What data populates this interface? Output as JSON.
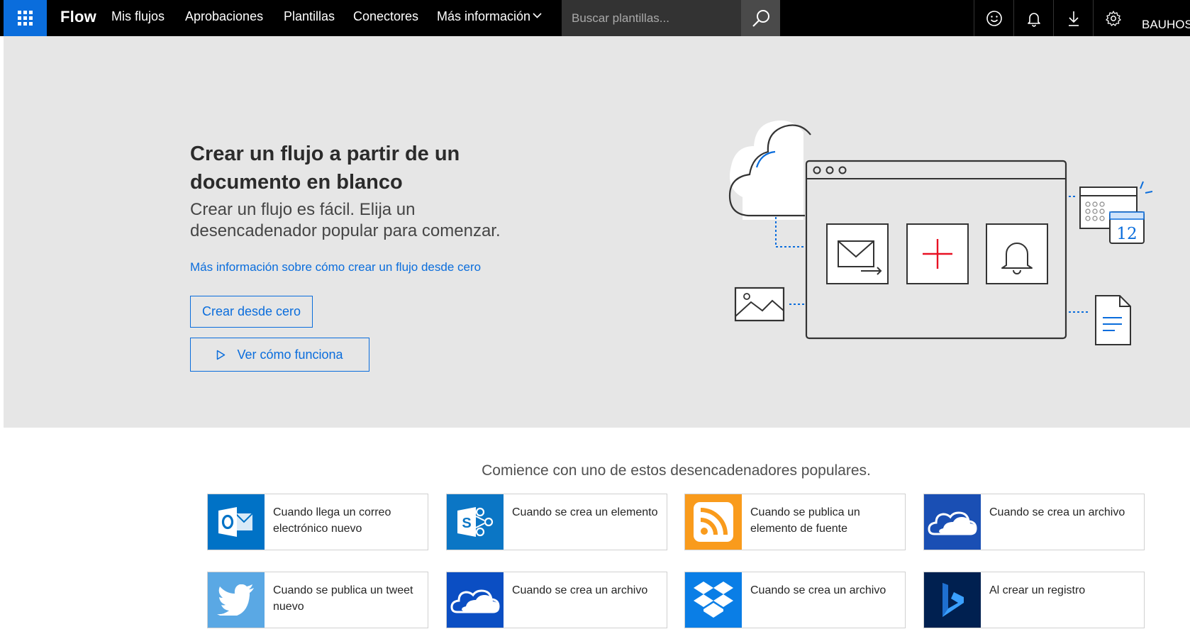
{
  "topbar": {
    "brand": "Flow",
    "nav": [
      "Mis flujos",
      "Aprobaciones",
      "Plantillas",
      "Conectores",
      "Más información"
    ],
    "search_placeholder": "Buscar plantillas...",
    "user": "BAUHOS",
    "accent": "#0a6ddc",
    "icons": [
      "app-launcher-icon",
      "search-icon",
      "smiley-icon",
      "bell-icon",
      "download-icon",
      "gear-icon"
    ]
  },
  "hero": {
    "title": "Crear un flujo a partir de un documento en blanco",
    "subtitle": "Crear un flujo es fácil. Elija un desencadenador popular para comenzar.",
    "link": "Más información sobre cómo crear un flujo desde cero",
    "create_button": "Crear desde cero",
    "watch_button": "Ver cómo funciona",
    "calendar_day": "12"
  },
  "triggers": {
    "title": "Comience con uno de estos desencadenadores populares.",
    "cards": [
      {
        "label": "Cuando llega un correo electrónico nuevo",
        "icon": "outlook-icon",
        "color": "#0072c6"
      },
      {
        "label": "Cuando se crea un elemento",
        "icon": "sharepoint-icon",
        "color": "#0b76c5"
      },
      {
        "label": "Cuando se publica un elemento de fuente",
        "icon": "rss-icon",
        "color": "#f99b1c"
      },
      {
        "label": "Cuando se crea un archivo",
        "icon": "onedrive-business-icon",
        "color": "#1a4fb4"
      },
      {
        "label": "Cuando se publica un tweet nuevo",
        "icon": "twitter-icon",
        "color": "#5aa8e4"
      },
      {
        "label": "Cuando se crea un archivo",
        "icon": "onedrive-icon",
        "color": "#0b4ec3"
      },
      {
        "label": "Cuando se crea un archivo",
        "icon": "dropbox-icon",
        "color": "#0a7ee6"
      },
      {
        "label": "Al crear un registro",
        "icon": "dynamics-icon",
        "color": "#002050"
      }
    ]
  }
}
